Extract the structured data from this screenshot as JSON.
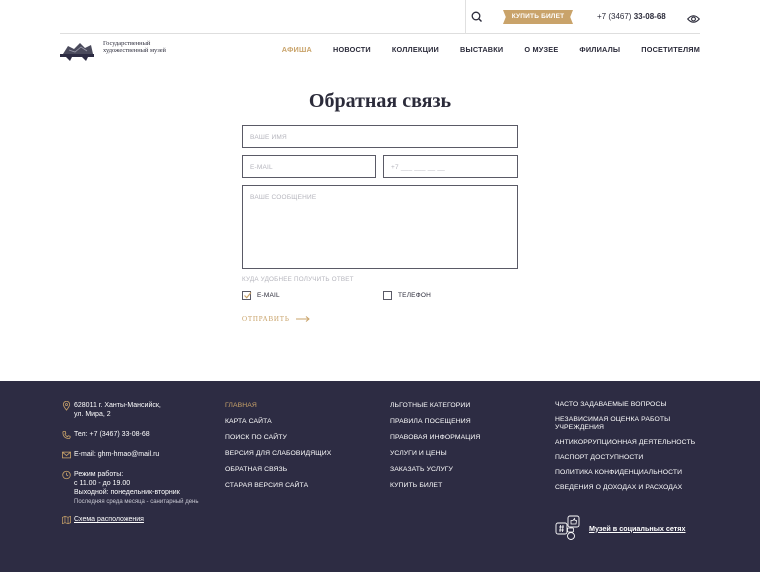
{
  "topbar": {
    "buy_ticket": "КУПИТЬ БИЛЕТ",
    "phone_prefix": "+7 (3467)",
    "phone_number": "33-08-68"
  },
  "header": {
    "logo_text": "Государственный художественный музей",
    "nav": [
      {
        "label": "АФИША",
        "active": true
      },
      {
        "label": "НОВОСТИ"
      },
      {
        "label": "КОЛЛЕКЦИИ"
      },
      {
        "label": "ВЫСТАВКИ"
      },
      {
        "label": "О МУЗЕЕ"
      },
      {
        "label": "ФИЛИАЛЫ"
      },
      {
        "label": "ПОСЕТИТЕЛЯМ"
      }
    ]
  },
  "form": {
    "title": "Обратная связь",
    "name_placeholder": "ВАШЕ ИМЯ",
    "email_placeholder": "E-MAIL",
    "phone_placeholder": "+7 ___ ___ __ __",
    "message_placeholder": "ВАШЕ СООБЩЕНИЕ",
    "reply_label": "КУДА УДОБНЕЕ ПОЛУЧИТЬ ОТВЕТ",
    "option_email": "E-MAIL",
    "option_email_checked": true,
    "option_phone": "ТЕЛЕФОН",
    "option_phone_checked": false,
    "submit": "ОТПРАВИТЬ"
  },
  "footer": {
    "address_line1": "628011 г. Ханты-Мансийск,",
    "address_line2": "ул. Мира, 2",
    "phone": "Тел: +7 (3467) 33-08-68",
    "email": "E-mail: ghm-hmao@mail.ru",
    "hours_title": "Режим работы:",
    "hours": "с 11.00 - до 19.00",
    "day_off": "Выходной: понедельник-вторник",
    "sanitary": "Последняя среда месяца - санитарный день",
    "scheme": "Схема расположения",
    "col2": [
      "ГЛАВНАЯ",
      "КАРТА САЙТА",
      "ПОИСК ПО САЙТУ",
      "ВЕРСИЯ ДЛЯ СЛАБОВИДЯЩИХ",
      "ОБРАТНАЯ СВЯЗЬ",
      "СТАРАЯ ВЕРСИЯ САЙТА"
    ],
    "col3": [
      "ЛЬГОТНЫЕ КАТЕГОРИИ",
      "ПРАВИЛА ПОСЕЩЕНИЯ",
      "ПРАВОВАЯ ИНФОРМАЦИЯ",
      "УСЛУГИ И ЦЕНЫ",
      "ЗАКАЗАТЬ УСЛУГУ",
      "КУПИТЬ БИЛЕТ"
    ],
    "col4": [
      "ЧАСТО ЗАДАВАЕМЫЕ ВОПРОСЫ",
      "НЕЗАВИСИМАЯ ОЦЕНКА РАБОТЫ УЧРЕЖДЕНИЯ",
      "АНТИКОРРУПЦИОННАЯ ДЕЯТЕЛЬНОСТЬ",
      "ПАСПОРТ ДОСТУПНОСТИ",
      "ПОЛИТИКА КОНФИДЕНЦИАЛЬНОСТИ",
      "СВЕДЕНИЯ О ДОХОДАХ И РАСХОДАХ"
    ],
    "social": "Музей в социальных сетях"
  },
  "colors": {
    "accent": "#c9a36a",
    "footer_bg": "#2d2c43",
    "text": "#2b2b3a"
  },
  "icons": [
    "search-icon",
    "eye-icon",
    "logo-icon",
    "location-icon",
    "phone-icon",
    "mail-icon",
    "clock-icon",
    "map-icon",
    "checkmark-icon",
    "arrow-right-icon",
    "social-icon"
  ]
}
